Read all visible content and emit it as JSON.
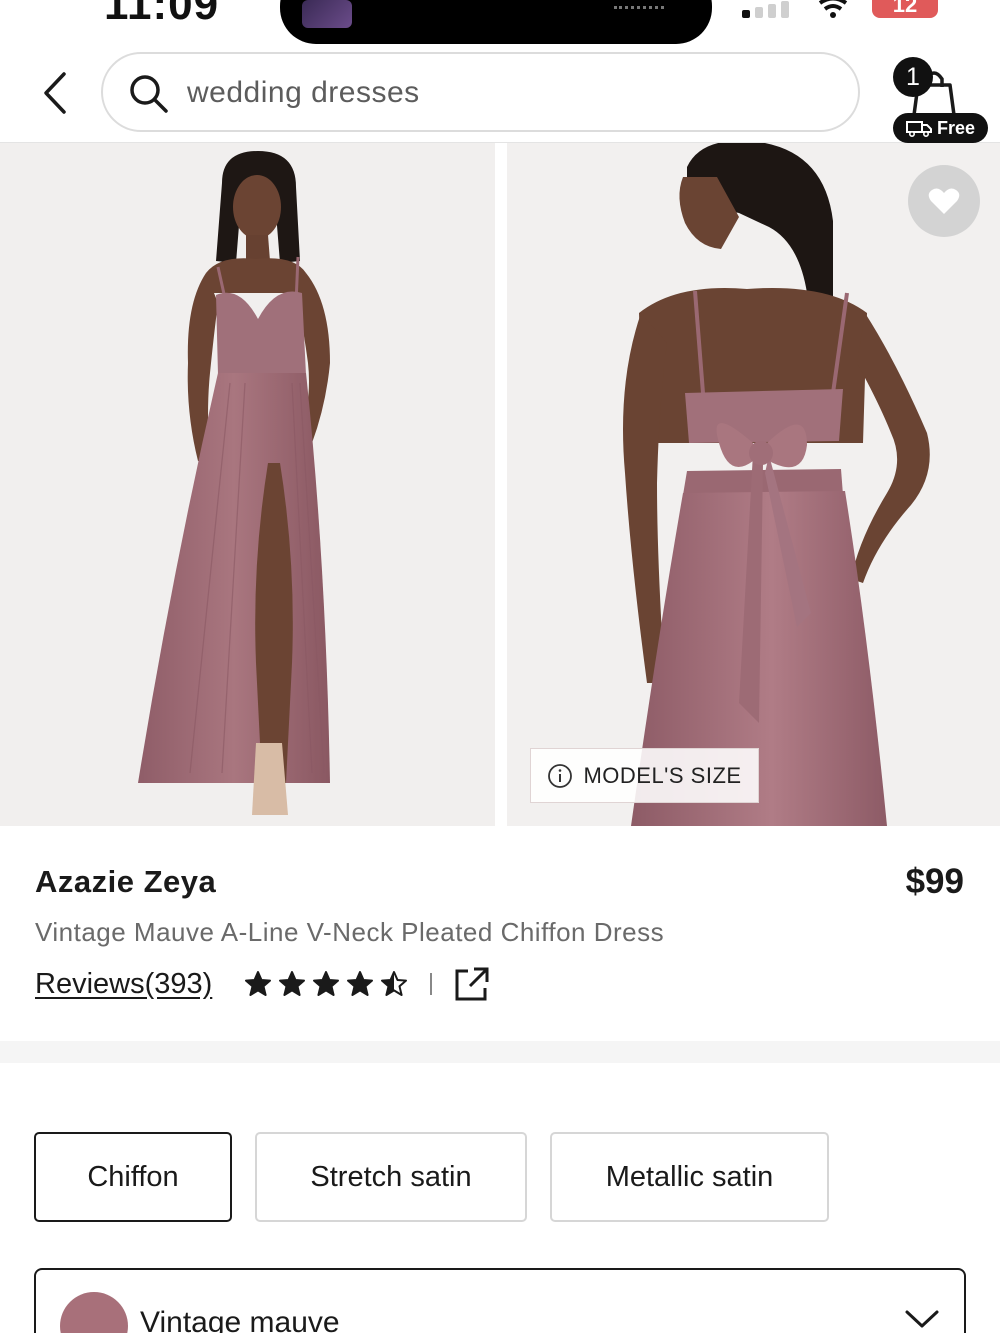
{
  "status_bar": {
    "time": "11:09",
    "battery": "12"
  },
  "header": {
    "search_value": "wedding dresses",
    "cart_count": "1",
    "free_label": "Free"
  },
  "gallery": {
    "model_size_label": "MODEL'S SIZE"
  },
  "product": {
    "brand": "Azazie Zeya",
    "price": "$99",
    "name": "Vintage Mauve A-Line V-Neck Pleated Chiffon Dress",
    "reviews_label": "Reviews(393)",
    "rating": 4.5,
    "rating_max": 5
  },
  "materials": [
    {
      "label": "Chiffon",
      "selected": true
    },
    {
      "label": "Stretch satin",
      "selected": false
    },
    {
      "label": "Metallic satin",
      "selected": false
    }
  ],
  "color": {
    "selected_name": "Vintage mauve",
    "swatch": "#a8707a"
  },
  "colors": {
    "dress": "#a06e78",
    "text_dark": "#1a1a1a",
    "text_muted": "#6a6a6a"
  }
}
